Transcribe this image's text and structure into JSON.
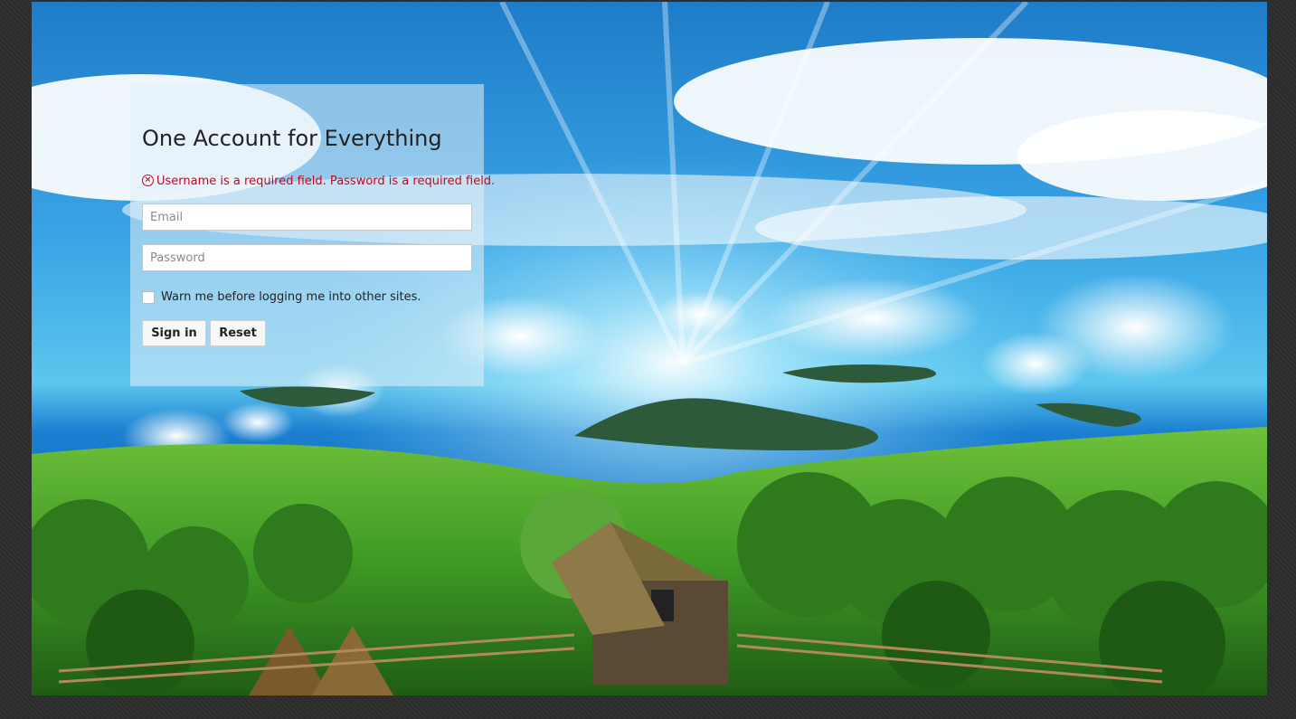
{
  "login": {
    "title": "One Account for Everything",
    "error_message": "Username is a required field. Password is a required field.",
    "error_icon": "error-circle-icon",
    "email_placeholder": "Email",
    "email_value": "",
    "password_placeholder": "Password",
    "password_value": "",
    "warn_checkbox_label": "Warn me before logging me into other sites.",
    "warn_checkbox_checked": false,
    "sign_in_label": "Sign in",
    "reset_label": "Reset"
  },
  "colors": {
    "error": "#d0021b",
    "panel_bg": "rgba(225,238,248,0.55)",
    "page_bg": "#2b2b2b"
  }
}
